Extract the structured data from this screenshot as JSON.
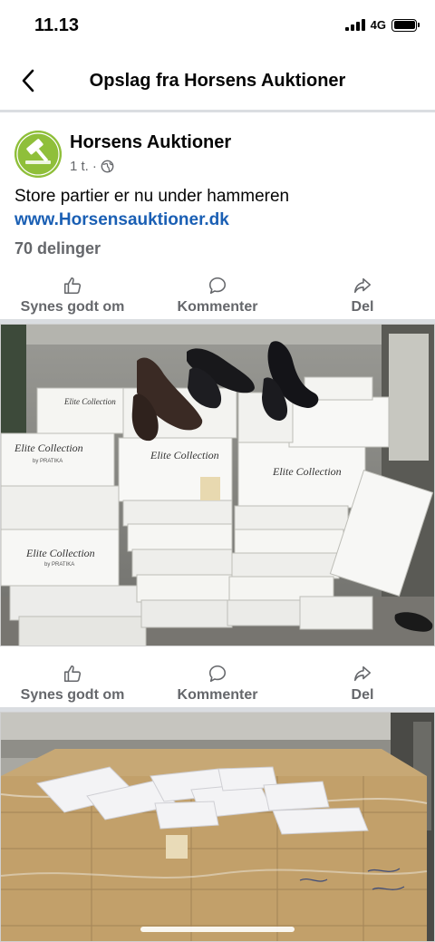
{
  "status_bar": {
    "time": "11.13",
    "network": "4G"
  },
  "nav": {
    "title": "Opslag fra Horsens Auktioner"
  },
  "post": {
    "page_name": "Horsens Auktioner",
    "time_ago": "1 t.",
    "separator": "·",
    "text": "Store partier er nu under hammeren",
    "link": "www.Horsensauktioner.dk",
    "shares": "70 delinger"
  },
  "actions": {
    "like": "Synes godt om",
    "comment": "Kommenter",
    "share": "Del"
  },
  "photo1": {
    "box_label": "Elite Collection",
    "box_sub": "by PRATIKA"
  },
  "icons": {
    "back": "chevron-left-icon",
    "globe": "globe-icon",
    "like": "thumbs-up-icon",
    "comment": "comment-bubble-icon",
    "share": "share-arrow-icon"
  },
  "colors": {
    "link": "#1a5fb4",
    "muted": "#65676b",
    "divider": "#dadde1",
    "avatar": "#8fbf3a"
  }
}
